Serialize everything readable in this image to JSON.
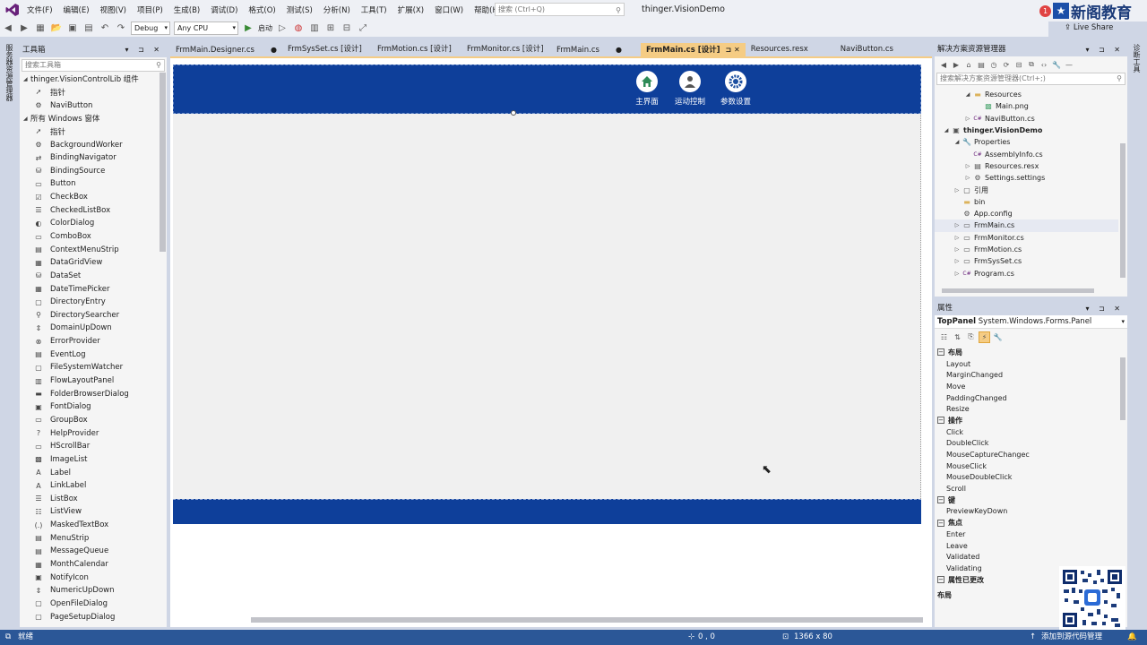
{
  "menubar": {
    "items": [
      "文件(F)",
      "编辑(E)",
      "视图(V)",
      "项目(P)",
      "生成(B)",
      "调试(D)",
      "格式(O)",
      "测试(S)",
      "分析(N)",
      "工具(T)",
      "扩展(X)",
      "窗口(W)",
      "帮助(H)"
    ],
    "search_placeholder": "搜索 (Ctrl+Q)",
    "solution_title": "thinger.VisionDemo",
    "live_share": "Live Share",
    "brand_badge": "1",
    "brand_name": "新阁教育"
  },
  "toolbar": {
    "config": "Debug",
    "platform": "Any CPU",
    "start": "启动"
  },
  "left_strip": {
    "label": "服务器资源管理器"
  },
  "right_strip": {
    "label": "诊断工具"
  },
  "toolbox": {
    "title": "工具箱",
    "search_placeholder": "搜索工具箱",
    "rows": [
      {
        "type": "group",
        "text": "thinger.VisionControlLib 组件"
      },
      {
        "type": "item",
        "icon": "pointer",
        "text": "指针"
      },
      {
        "type": "item",
        "icon": "gear",
        "text": "NaviButton"
      },
      {
        "type": "group",
        "text": "所有 Windows 窗体"
      },
      {
        "type": "item",
        "icon": "pointer",
        "text": "指针"
      },
      {
        "type": "item",
        "icon": "gear",
        "text": "BackgroundWorker"
      },
      {
        "type": "item",
        "icon": "nav",
        "text": "BindingNavigator"
      },
      {
        "type": "item",
        "icon": "db",
        "text": "BindingSource"
      },
      {
        "type": "item",
        "icon": "btn",
        "text": "Button"
      },
      {
        "type": "item",
        "icon": "check",
        "text": "CheckBox"
      },
      {
        "type": "item",
        "icon": "list",
        "text": "CheckedListBox"
      },
      {
        "type": "item",
        "icon": "color",
        "text": "ColorDialog"
      },
      {
        "type": "item",
        "icon": "combo",
        "text": "ComboBox"
      },
      {
        "type": "item",
        "icon": "menu",
        "text": "ContextMenuStrip"
      },
      {
        "type": "item",
        "icon": "grid",
        "text": "DataGridView"
      },
      {
        "type": "item",
        "icon": "db",
        "text": "DataSet"
      },
      {
        "type": "item",
        "icon": "cal",
        "text": "DateTimePicker"
      },
      {
        "type": "item",
        "icon": "dir",
        "text": "DirectoryEntry"
      },
      {
        "type": "item",
        "icon": "search",
        "text": "DirectorySearcher"
      },
      {
        "type": "item",
        "icon": "updown",
        "text": "DomainUpDown"
      },
      {
        "type": "item",
        "icon": "error",
        "text": "ErrorProvider"
      },
      {
        "type": "item",
        "icon": "log",
        "text": "EventLog"
      },
      {
        "type": "item",
        "icon": "file",
        "text": "FileSystemWatcher"
      },
      {
        "type": "item",
        "icon": "flow",
        "text": "FlowLayoutPanel"
      },
      {
        "type": "item",
        "icon": "folder",
        "text": "FolderBrowserDialog"
      },
      {
        "type": "item",
        "icon": "font",
        "text": "FontDialog"
      },
      {
        "type": "item",
        "icon": "group",
        "text": "GroupBox"
      },
      {
        "type": "item",
        "icon": "help",
        "text": "HelpProvider"
      },
      {
        "type": "item",
        "icon": "hscroll",
        "text": "HScrollBar"
      },
      {
        "type": "item",
        "icon": "image",
        "text": "ImageList"
      },
      {
        "type": "item",
        "icon": "label",
        "text": "Label"
      },
      {
        "type": "item",
        "icon": "label",
        "text": "LinkLabel"
      },
      {
        "type": "item",
        "icon": "list",
        "text": "ListBox"
      },
      {
        "type": "item",
        "icon": "listview",
        "text": "ListView"
      },
      {
        "type": "item",
        "icon": "masked",
        "text": "MaskedTextBox"
      },
      {
        "type": "item",
        "icon": "menu",
        "text": "MenuStrip"
      },
      {
        "type": "item",
        "icon": "queue",
        "text": "MessageQueue"
      },
      {
        "type": "item",
        "icon": "cal",
        "text": "MonthCalendar"
      },
      {
        "type": "item",
        "icon": "notify",
        "text": "NotifyIcon"
      },
      {
        "type": "item",
        "icon": "updown",
        "text": "NumericUpDown"
      },
      {
        "type": "item",
        "icon": "file",
        "text": "OpenFileDialog"
      },
      {
        "type": "item",
        "icon": "page",
        "text": "PageSetupDialog"
      }
    ]
  },
  "doc_tabs": [
    {
      "text": "FrmMain.Designer.cs",
      "active": false,
      "dot": true
    },
    {
      "text": "FrmSysSet.cs [设计]",
      "active": false,
      "dot": false
    },
    {
      "text": "FrmMotion.cs [设计]",
      "active": false,
      "dot": false
    },
    {
      "text": "FrmMonitor.cs [设计]",
      "active": false,
      "dot": false
    },
    {
      "text": "FrmMain.cs",
      "active": false,
      "dot": true
    },
    {
      "text": "FrmMain.cs [设计]",
      "active": true,
      "dot": false
    },
    {
      "text": "Resources.resx",
      "active": false,
      "dot": false
    },
    {
      "text": "NaviButton.cs",
      "active": false,
      "dot": false
    }
  ],
  "designer": {
    "nav_buttons": [
      {
        "icon": "home",
        "label": "主界面"
      },
      {
        "icon": "user",
        "label": "运动控制"
      },
      {
        "icon": "gear",
        "label": "参数设置"
      }
    ],
    "colors": {
      "panel": "#0e3f9a"
    }
  },
  "solution_explorer": {
    "title": "解决方案资源管理器",
    "search_placeholder": "搜索解决方案资源管理器(Ctrl+;)",
    "rows": [
      {
        "indent": 2,
        "tri": "open",
        "icon": "folder",
        "text": "Resources",
        "bold": false,
        "sel": false
      },
      {
        "indent": 3,
        "tri": "",
        "icon": "image",
        "text": "Main.png",
        "bold": false,
        "sel": false
      },
      {
        "indent": 2,
        "tri": "closed",
        "icon": "cs",
        "text": "NaviButton.cs",
        "bold": false,
        "sel": false
      },
      {
        "indent": 0,
        "tri": "open",
        "icon": "project",
        "text": "thinger.VisionDemo",
        "bold": true,
        "sel": false
      },
      {
        "indent": 1,
        "tri": "open",
        "icon": "wrench",
        "text": "Properties",
        "bold": false,
        "sel": false
      },
      {
        "indent": 2,
        "tri": "",
        "icon": "cs",
        "text": "AssemblyInfo.cs",
        "bold": false,
        "sel": false
      },
      {
        "indent": 2,
        "tri": "closed",
        "icon": "resx",
        "text": "Resources.resx",
        "bold": false,
        "sel": false
      },
      {
        "indent": 2,
        "tri": "closed",
        "icon": "settings",
        "text": "Settings.settings",
        "bold": false,
        "sel": false
      },
      {
        "indent": 1,
        "tri": "closed",
        "icon": "ref",
        "text": "引用",
        "bold": false,
        "sel": false
      },
      {
        "indent": 1,
        "tri": "",
        "icon": "folder",
        "text": "bin",
        "bold": false,
        "sel": false
      },
      {
        "indent": 1,
        "tri": "",
        "icon": "config",
        "text": "App.config",
        "bold": false,
        "sel": false
      },
      {
        "indent": 1,
        "tri": "closed",
        "icon": "form",
        "text": "FrmMain.cs",
        "bold": false,
        "sel": true
      },
      {
        "indent": 1,
        "tri": "closed",
        "icon": "form",
        "text": "FrmMonitor.cs",
        "bold": false,
        "sel": false
      },
      {
        "indent": 1,
        "tri": "closed",
        "icon": "form",
        "text": "FrmMotion.cs",
        "bold": false,
        "sel": false
      },
      {
        "indent": 1,
        "tri": "closed",
        "icon": "form",
        "text": "FrmSysSet.cs",
        "bold": false,
        "sel": false
      },
      {
        "indent": 1,
        "tri": "closed",
        "icon": "cs",
        "text": "Program.cs",
        "bold": false,
        "sel": false
      }
    ]
  },
  "properties": {
    "title": "属性",
    "object_name": "TopPanel",
    "object_type": "System.Windows.Forms.Panel",
    "rows": [
      {
        "type": "cat",
        "text": "布局"
      },
      {
        "type": "item",
        "text": "Layout"
      },
      {
        "type": "item",
        "text": "MarginChanged"
      },
      {
        "type": "item",
        "text": "Move"
      },
      {
        "type": "item",
        "text": "PaddingChanged"
      },
      {
        "type": "item",
        "text": "Resize"
      },
      {
        "type": "cat",
        "text": "操作"
      },
      {
        "type": "item",
        "text": "Click"
      },
      {
        "type": "item",
        "text": "DoubleClick"
      },
      {
        "type": "item",
        "text": "MouseCaptureChangec"
      },
      {
        "type": "item",
        "text": "MouseClick"
      },
      {
        "type": "item",
        "text": "MouseDoubleClick"
      },
      {
        "type": "item",
        "text": "Scroll"
      },
      {
        "type": "cat",
        "text": "键"
      },
      {
        "type": "item",
        "text": "PreviewKeyDown"
      },
      {
        "type": "cat",
        "text": "焦点"
      },
      {
        "type": "item",
        "text": "Enter"
      },
      {
        "type": "item",
        "text": "Leave"
      },
      {
        "type": "item",
        "text": "Validated"
      },
      {
        "type": "item",
        "text": "Validating"
      },
      {
        "type": "cat",
        "text": "属性已更改"
      }
    ],
    "description": "布局"
  },
  "statusbar": {
    "ready": "就绪",
    "position": "0 , 0",
    "size": "1366 x 80",
    "source_control": "添加到源代码管理"
  }
}
